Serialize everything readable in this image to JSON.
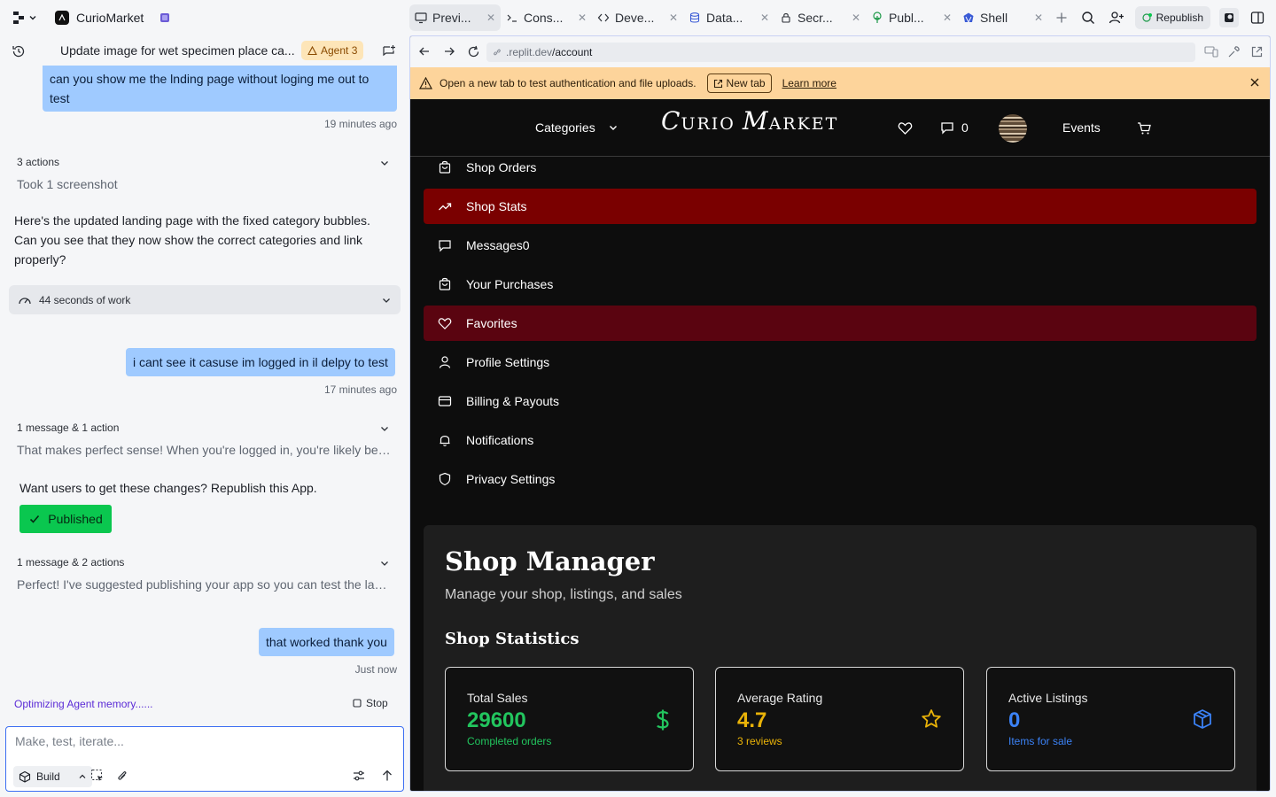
{
  "topbar": {
    "app_name": "CurioMarket",
    "tabs": [
      {
        "label": "Previ...",
        "icon": "monitor-icon"
      },
      {
        "label": "Cons...",
        "icon": "terminal-prompt-icon"
      },
      {
        "label": "Deve...",
        "icon": "code-icon"
      },
      {
        "label": "Data...",
        "icon": "database-icon"
      },
      {
        "label": "Secr...",
        "icon": "lock-icon"
      },
      {
        "label": "Publ...",
        "icon": "publish-tree-icon"
      },
      {
        "label": "Shell",
        "icon": "shell-icon"
      }
    ],
    "republish_label": "Republish"
  },
  "chat": {
    "title": "Update image for wet specimen place ca...",
    "agent_badge": "Agent 3",
    "messages": {
      "user1": "can you show me the lnding page without loging me out to test",
      "user1_time": "19 minutes ago",
      "actions1_head": "3 actions",
      "actions1_sub": "Took 1 screenshot",
      "agent1": "Here's the updated landing page with the fixed category bubbles. Can you see that they now show the correct categories and link properly?",
      "work_time": "44 seconds of work",
      "user2": "i cant see it casuse im logged in il delpy to test",
      "user2_time": "17 minutes ago",
      "actions2_head": "1 message & 1 action",
      "actions2_sub": "That makes perfect sense! When you're logged in, you're likely being shown a different view...",
      "republish_prompt": "Want users to get these changes? Republish this App.",
      "published_label": "Published",
      "actions3_head": "1 message & 2 actions",
      "actions3_sub": "Perfect! I've suggested publishing your app so you can test the landing page...",
      "user3": "that worked thank you",
      "user3_time": "Just now"
    },
    "status": "Optimizing Agent memory......",
    "stop_label": "Stop",
    "composer": {
      "placeholder": "Make, test, iterate...",
      "mode_label": "Build"
    }
  },
  "preview": {
    "url_prefix": ".replit.dev",
    "url_path": "/account",
    "banner": {
      "text": "Open a new tab to test authentication and file uploads.",
      "new_tab_label": "New tab",
      "learn_more": "Learn more"
    },
    "nav": {
      "categories": "Categories",
      "brand_big1": "C",
      "brand_small1": "URIO ",
      "brand_big2": "M",
      "brand_small2": "ARKET",
      "messages_count": "0",
      "events": "Events"
    },
    "menu": [
      {
        "label": "Shop Orders",
        "icon": "shopping-bag-icon",
        "state": "normal"
      },
      {
        "label": "Shop Stats",
        "icon": "trending-up-icon",
        "state": "active"
      },
      {
        "label": "Messages0",
        "icon": "message-icon",
        "state": "normal"
      },
      {
        "label": "Your Purchases",
        "icon": "shopping-bag-icon",
        "state": "normal"
      },
      {
        "label": "Favorites",
        "icon": "heart-icon",
        "state": "fav"
      },
      {
        "label": "Profile Settings",
        "icon": "user-icon",
        "state": "normal"
      },
      {
        "label": "Billing & Payouts",
        "icon": "credit-card-icon",
        "state": "normal"
      },
      {
        "label": "Notifications",
        "icon": "bell-icon",
        "state": "normal"
      },
      {
        "label": "Privacy Settings",
        "icon": "shield-icon",
        "state": "normal"
      }
    ],
    "shop": {
      "title": "Shop Manager",
      "subtitle": "Manage your shop, listings, and sales",
      "stats_title": "Shop Statistics",
      "stats": [
        {
          "label": "Total Sales",
          "value": "29600",
          "note": "Completed orders",
          "color": "#22c55e",
          "icon": "dollar-icon"
        },
        {
          "label": "Average Rating",
          "value": "4.7",
          "note": "3 reviews",
          "color": "#eab308",
          "icon": "star-icon"
        },
        {
          "label": "Active Listings",
          "value": "0",
          "note": "Items for sale",
          "color": "#3b82f6",
          "icon": "package-icon"
        }
      ]
    }
  },
  "colors": {
    "accent_blue": "#3d6ff2",
    "user_bubble": "#9fcaff",
    "published_green": "#0ac74f",
    "active_menu": "#7a0000",
    "favorites_menu": "#5a0410",
    "banner": "#fdd49b"
  }
}
